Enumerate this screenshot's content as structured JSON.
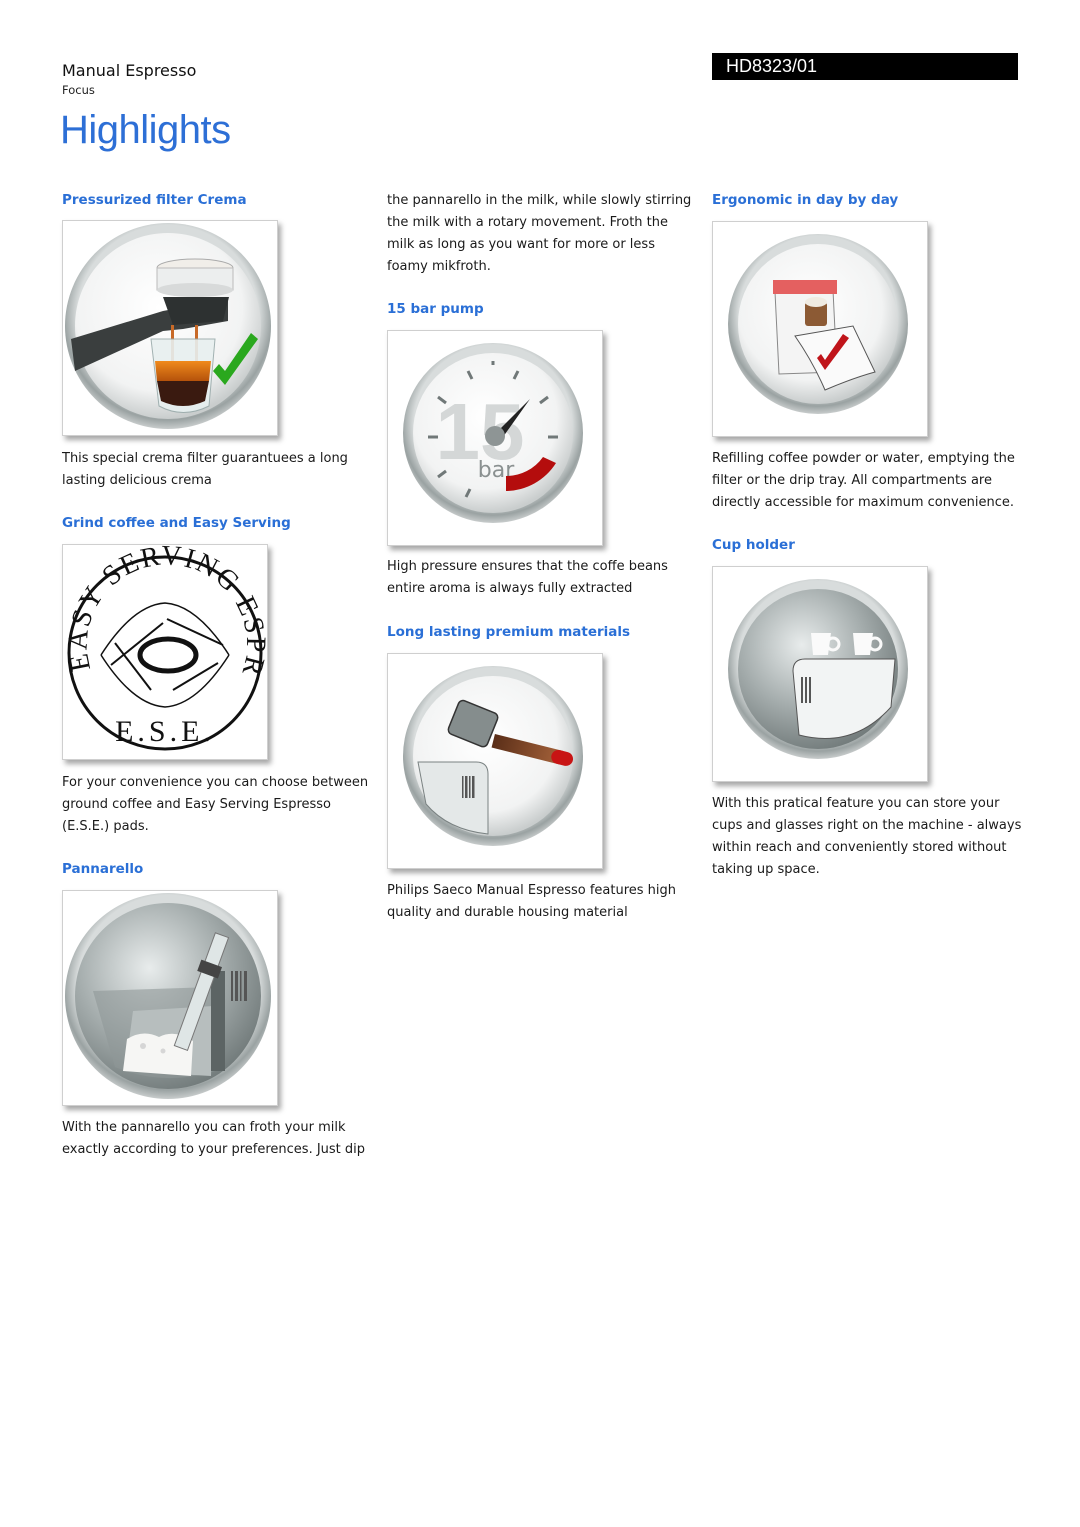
{
  "header": {
    "product_name": "Manual Espresso",
    "product_line": "Focus",
    "model_number": "HD8323/01",
    "page_title": "Highlights"
  },
  "colors": {
    "heading_blue": "#2a6fd6",
    "title_blue": "#2d6fd6",
    "model_box_bg": "#000000"
  },
  "features": [
    {
      "id": "pressurized-filter-crema",
      "title": "Pressurized filter Crema",
      "image": "espresso-crema-check-icon",
      "description": "This special crema filter guarantuees a long lasting delicious crema"
    },
    {
      "id": "grind-coffee-easy-serving",
      "title": "Grind coffee and Easy Serving",
      "image": "ese-logo",
      "image_text": {
        "ring_top": "EASY SERVING ESPRESSO",
        "bottom": "E.S.E."
      },
      "description": "For your convenience you can choose between ground coffee and Easy Serving Espresso (E.S.E.) pads."
    },
    {
      "id": "pannarello",
      "title": "Pannarello",
      "image": "pannarello-frother-icon",
      "description_part1": "With the pannarello you can froth your milk exactly according to your preferences. Just dip",
      "description_part2": "the pannarello in the milk, while slowly stirring the milk with a rotary movement. Froth the milk as long as you want for more or less foamy mikfroth."
    },
    {
      "id": "15-bar-pump",
      "title": "15 bar pump",
      "image": "pressure-gauge-icon",
      "image_text": {
        "number": "15",
        "unit": "bar"
      },
      "description": "High pressure ensures that the coffe beans entire aroma is always fully extracted"
    },
    {
      "id": "long-lasting-materials",
      "title": "Long lasting premium materials",
      "image": "hammer-icon",
      "description": "Philips Saeco Manual Espresso features high quality and durable housing material"
    },
    {
      "id": "ergonomic",
      "title": "Ergonomic in day by day",
      "image": "calendar-check-icon",
      "description": "Refilling coffee powder or water, emptying the filter or the drip tray. All compartments are directly accessible for maximum convenience."
    },
    {
      "id": "cup-holder",
      "title": "Cup holder",
      "image": "cup-holder-icon",
      "description": "With this pratical feature you can store your cups and glasses right on the machine - always within reach and conveniently stored without taking up space."
    }
  ]
}
